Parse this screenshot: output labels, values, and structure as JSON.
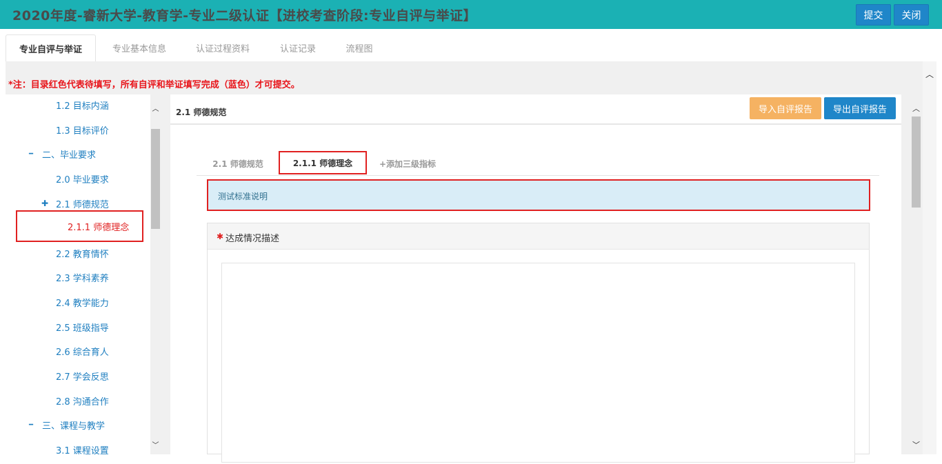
{
  "header": {
    "title": "2020年度-睿新大学-教育学-专业二级认证【进校考查阶段:专业自评与举证】",
    "submit_label": "提交",
    "close_label": "关闭"
  },
  "tabs": [
    {
      "label": "专业自评与举证",
      "active": true
    },
    {
      "label": "专业基本信息",
      "active": false
    },
    {
      "label": "认证过程资料",
      "active": false
    },
    {
      "label": "认证记录",
      "active": false
    },
    {
      "label": "流程图",
      "active": false
    }
  ],
  "note": "*注：目录红色代表待填写，所有自评和举证填写完成（蓝色）才可提交。",
  "tree": {
    "items": [
      {
        "label": "1.2 目标内涵",
        "prefix": ""
      },
      {
        "label": "1.3 目标评价",
        "prefix": ""
      },
      {
        "label": "二、毕业要求",
        "prefix": "━"
      },
      {
        "label": "2.0 毕业要求",
        "prefix": ""
      },
      {
        "label": "2.1 师德规范",
        "prefix": "✚"
      },
      {
        "label": "2.1.1 师德理念",
        "prefix": ""
      },
      {
        "label": "2.2 教育情怀",
        "prefix": ""
      },
      {
        "label": "2.3 学科素养",
        "prefix": ""
      },
      {
        "label": "2.4 教学能力",
        "prefix": ""
      },
      {
        "label": "2.5 班级指导",
        "prefix": ""
      },
      {
        "label": "2.6 综合育人",
        "prefix": ""
      },
      {
        "label": "2.7 学会反思",
        "prefix": ""
      },
      {
        "label": "2.8 沟通合作",
        "prefix": ""
      },
      {
        "label": "三、课程与教学",
        "prefix": "━"
      },
      {
        "label": "3.1 课程设置",
        "prefix": ""
      }
    ]
  },
  "panel": {
    "title": "2.1 师德规范",
    "import_label": "导入自评报告",
    "export_label": "导出自评报告",
    "subtabs": [
      "2.1 师德规范",
      "2.1.1 师德理念",
      "+添加三级指标"
    ],
    "description": "测试标准说明",
    "card_label": "达成情况描述",
    "required_mark": "✱"
  },
  "colors": {
    "header_bg": "#1bb1b4",
    "primary_button": "#1f86c9",
    "import_button": "#f5b262",
    "pending_red": "#e02020",
    "done_blue": "#1f7fc0"
  }
}
